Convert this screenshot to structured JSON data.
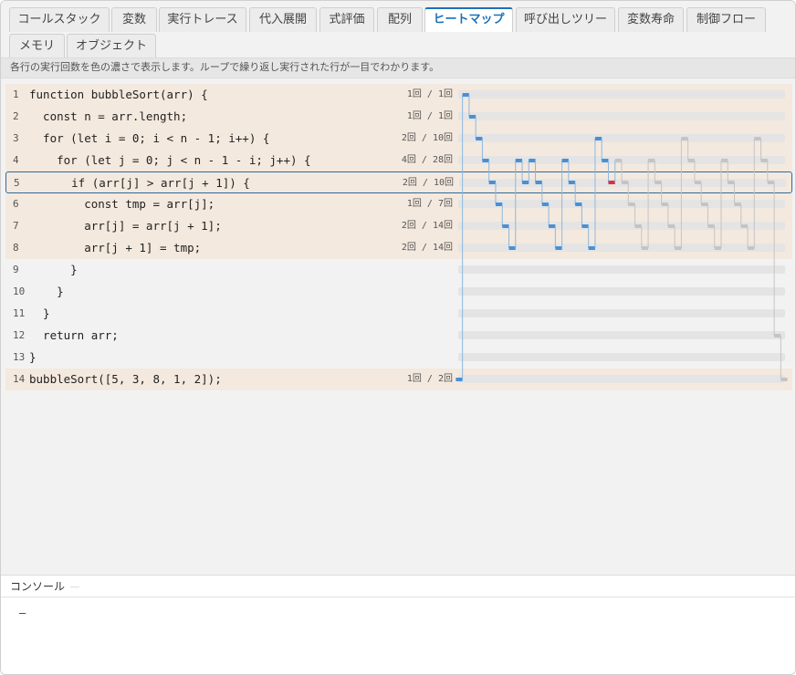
{
  "tabs": [
    {
      "label": "コールスタック",
      "active": false
    },
    {
      "label": "変数",
      "active": false
    },
    {
      "label": "実行トレース",
      "active": false
    },
    {
      "label": "代入展開",
      "active": false
    },
    {
      "label": "式評価",
      "active": false
    },
    {
      "label": "配列",
      "active": false
    },
    {
      "label": "ヒートマップ",
      "active": true
    },
    {
      "label": "呼び出しツリー",
      "active": false
    },
    {
      "label": "変数寿命",
      "active": false
    },
    {
      "label": "制御フロー",
      "active": false
    },
    {
      "label": "メモリ",
      "active": false
    },
    {
      "label": "オブジェクト",
      "active": false
    }
  ],
  "description": "各行の実行回数を色の濃さで表示します。ループで繰り返し実行された行が一目でわかります。",
  "current_line": 5,
  "code_lines": [
    {
      "num": "1",
      "code": "function bubbleSort(arr) {",
      "count": "1回 / 1回",
      "heat": true
    },
    {
      "num": "2",
      "code": "  const n = arr.length;",
      "count": "1回 / 1回",
      "heat": true
    },
    {
      "num": "3",
      "code": "  for (let i = 0; i < n - 1; i++) {",
      "count": "2回 / 10回",
      "heat": true
    },
    {
      "num": "4",
      "code": "    for (let j = 0; j < n - 1 - i; j++) {",
      "count": "4回 / 28回",
      "heat": true
    },
    {
      "num": "5",
      "code": "      if (arr[j] > arr[j + 1]) {",
      "count": "2回 / 10回",
      "heat": true
    },
    {
      "num": "6",
      "code": "        const tmp = arr[j];",
      "count": "1回 / 7回",
      "heat": true
    },
    {
      "num": "7",
      "code": "        arr[j] = arr[j + 1];",
      "count": "2回 / 14回",
      "heat": true
    },
    {
      "num": "8",
      "code": "        arr[j + 1] = tmp;",
      "count": "2回 / 14回",
      "heat": true
    },
    {
      "num": "9",
      "code": "      }",
      "count": "",
      "heat": false
    },
    {
      "num": "10",
      "code": "    }",
      "count": "",
      "heat": false
    },
    {
      "num": "11",
      "code": "  }",
      "count": "",
      "heat": false
    },
    {
      "num": "12",
      "code": "  return arr;",
      "count": "",
      "heat": false
    },
    {
      "num": "13",
      "code": "}",
      "count": "",
      "heat": false
    },
    {
      "num": "14",
      "code": "bubbleSort([5, 3, 8, 1, 2]);",
      "count": "1回 / 2回",
      "heat": true
    }
  ],
  "timeline_colors": {
    "executed": "#4a8fd4",
    "future": "#c4c4c4",
    "current": "#d9343d",
    "connector": "#8db8e0"
  },
  "console": {
    "title": "コンソール",
    "output": "—"
  }
}
